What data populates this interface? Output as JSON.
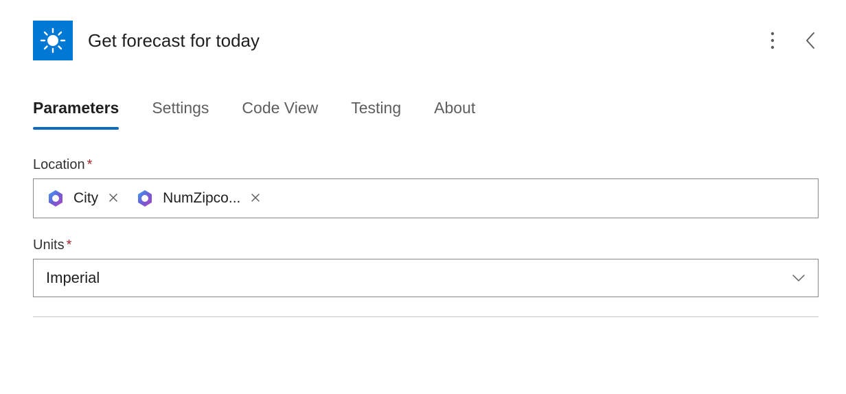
{
  "header": {
    "title": "Get forecast for today",
    "icon": "weather-sunny-icon"
  },
  "tabs": [
    {
      "label": "Parameters",
      "active": true
    },
    {
      "label": "Settings",
      "active": false
    },
    {
      "label": "Code View",
      "active": false
    },
    {
      "label": "Testing",
      "active": false
    },
    {
      "label": "About",
      "active": false
    }
  ],
  "form": {
    "location": {
      "label": "Location",
      "required": "*",
      "tokens": [
        {
          "label": "City"
        },
        {
          "label": "NumZipco..."
        }
      ]
    },
    "units": {
      "label": "Units",
      "required": "*",
      "value": "Imperial"
    }
  }
}
